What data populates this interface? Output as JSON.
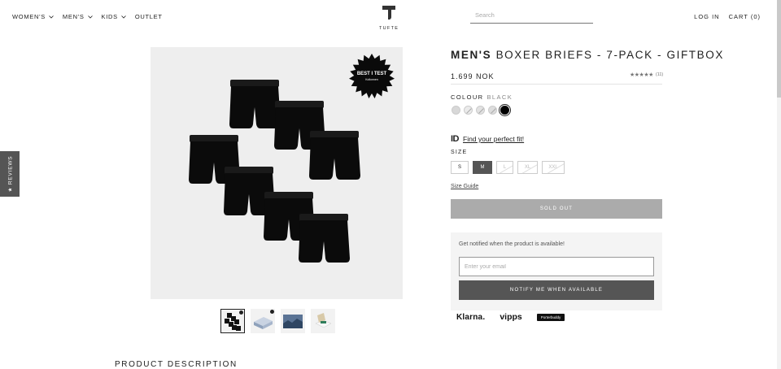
{
  "header": {
    "nav": [
      {
        "label": "WOMEN'S",
        "has_dropdown": true
      },
      {
        "label": "MEN'S",
        "has_dropdown": true
      },
      {
        "label": "KIDS",
        "has_dropdown": true
      },
      {
        "label": "OUTLET",
        "has_dropdown": false
      }
    ],
    "logo_text": "TUFTE",
    "search_placeholder": "Search",
    "login_label": "LOG IN",
    "cart_label": "CART (0)"
  },
  "reviews_tab": {
    "label": "★ REVIEWS"
  },
  "product": {
    "title_bold": "MEN'S",
    "title_rest": " BOXER BRIEFS - 7-PACK - GIFTBOX",
    "price": "1.699 NOK",
    "rating_stars": "★★★★★",
    "rating_count": "(11)",
    "colour_label": "COLOUR",
    "colour_value": "BLACK",
    "swatches": [
      {
        "color": "#d8d8d8",
        "available": true
      },
      {
        "color": "#ebebeb",
        "available": false
      },
      {
        "color": "#e2e2e2",
        "available": false
      },
      {
        "color": "#dddddd",
        "available": false
      },
      {
        "color": "#000000",
        "available": true,
        "selected": true
      }
    ],
    "badge_text": "BEST I TEST",
    "badge_sub": "Kollonnen",
    "find_fit_icon": "ID",
    "find_fit_label": "Find your perfect fit!",
    "size_label": "SIZE",
    "sizes": [
      {
        "label": "S",
        "state": "available"
      },
      {
        "label": "M",
        "state": "selected"
      },
      {
        "label": "L",
        "state": "unavailable"
      },
      {
        "label": "XL",
        "state": "unavailable"
      },
      {
        "label": "XXL",
        "state": "unavailable"
      }
    ],
    "size_guide_label": "Size Guide",
    "sold_out_label": "SOLD OUT",
    "notify_text": "Get notified when the product is available!",
    "email_placeholder": "Enter your email",
    "notify_button_label": "NOTIFY ME WHEN AVAILABLE",
    "payments": {
      "klarna": "Klarna.",
      "vipps": "vipps",
      "porterbuddy": "Porterbuddy"
    }
  },
  "section_heading": "PRODUCT DESCRIPTION",
  "colors": {
    "accent_dark": "#555555",
    "sold_out": "#ababab",
    "notify_bg": "#f4f4f4"
  }
}
